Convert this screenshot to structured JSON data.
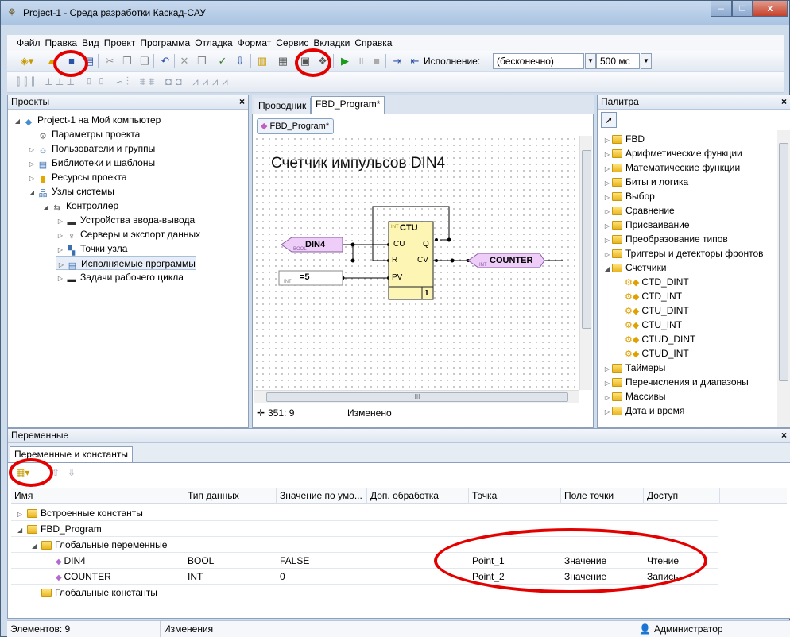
{
  "window": {
    "title": "Project-1 - Среда разработки Каскад-САУ",
    "min": "–",
    "max": "□",
    "close": "x"
  },
  "menu": [
    "Файл",
    "Правка",
    "Вид",
    "Проект",
    "Программа",
    "Отладка",
    "Формат",
    "Сервис",
    "Вкладки",
    "Справка"
  ],
  "toolbar": {
    "exec_label": "Исполнение:",
    "exec_value": "(бесконечно)",
    "period_value": "500 мс"
  },
  "projects": {
    "title": "Проекты",
    "close": "×",
    "items": [
      {
        "label": "Project-1 на Мой компьютер",
        "icon": "project-icon",
        "level": 0,
        "expanded": true
      },
      {
        "label": "Параметры проекта",
        "icon": "settings-icon",
        "level": 1
      },
      {
        "label": "Пользователи и группы",
        "icon": "users-icon",
        "level": 1,
        "collapsed": true
      },
      {
        "label": "Библиотеки и шаблоны",
        "icon": "library-icon",
        "level": 1,
        "collapsed": true
      },
      {
        "label": "Ресурсы проекта",
        "icon": "resources-icon",
        "level": 1,
        "collapsed": true
      },
      {
        "label": "Узлы системы",
        "icon": "network-icon",
        "level": 1,
        "expanded": true
      },
      {
        "label": "Контроллер",
        "icon": "controller-icon",
        "level": 2,
        "expanded": true
      },
      {
        "label": "Устройства ввода-вывода",
        "icon": "io-device-icon",
        "level": 3,
        "collapsed": true
      },
      {
        "label": "Серверы и экспорт данных",
        "icon": "server-icon",
        "level": 3,
        "collapsed": true
      },
      {
        "label": "Точки узла",
        "icon": "points-icon",
        "level": 3,
        "collapsed": true
      },
      {
        "label": "Исполняемые программы",
        "icon": "programs-icon",
        "level": 3,
        "collapsed": true,
        "selected": true
      },
      {
        "label": "Задачи рабочего цикла",
        "icon": "tasks-icon",
        "level": 3,
        "collapsed": true
      }
    ]
  },
  "editor": {
    "tabs": [
      "Проводник",
      "FBD_Program*"
    ],
    "doc_tab": "FBD_Program*",
    "title": "Счетчик импульсов DIN4",
    "block": {
      "type_tag": "INT",
      "name": "CTU",
      "in1": "CU",
      "in2": "R",
      "in3": "PV",
      "out1": "Q",
      "out2": "CV",
      "order": "1"
    },
    "din4": {
      "type_tag": "BOOL",
      "name": "DIN4"
    },
    "const": {
      "type_tag": "INT",
      "name": "=5"
    },
    "counter": {
      "type_tag": "INT",
      "name": "COUNTER"
    },
    "coords": "351: 9",
    "status": "Изменено",
    "hscroll_mark": "III"
  },
  "palette": {
    "title": "Палитра",
    "close": "×",
    "items": [
      {
        "label": "FBD",
        "kind": "folder"
      },
      {
        "label": "Арифметические функции",
        "kind": "folder"
      },
      {
        "label": "Математические функции",
        "kind": "folder"
      },
      {
        "label": "Биты и логика",
        "kind": "folder"
      },
      {
        "label": "Выбор",
        "kind": "folder"
      },
      {
        "label": "Сравнение",
        "kind": "folder"
      },
      {
        "label": "Присваивание",
        "kind": "folder"
      },
      {
        "label": "Преобразование типов",
        "kind": "folder"
      },
      {
        "label": "Триггеры и детекторы фронтов",
        "kind": "folder"
      },
      {
        "label": "Счетчики",
        "kind": "folder-open"
      },
      {
        "label": "CTD_DINT",
        "kind": "block"
      },
      {
        "label": "CTD_INT",
        "kind": "block"
      },
      {
        "label": "CTU_DINT",
        "kind": "block"
      },
      {
        "label": "CTU_INT",
        "kind": "block"
      },
      {
        "label": "CTUD_DINT",
        "kind": "block"
      },
      {
        "label": "CTUD_INT",
        "kind": "block"
      },
      {
        "label": "Таймеры",
        "kind": "folder"
      },
      {
        "label": "Перечисления и диапазоны",
        "kind": "folder"
      },
      {
        "label": "Массивы",
        "kind": "folder"
      },
      {
        "label": "Дата и время",
        "kind": "folder"
      }
    ]
  },
  "variables": {
    "title": "Переменные",
    "close": "×",
    "tab": "Переменные и константы",
    "columns": [
      "Имя",
      "Тип данных",
      "Значение по умо...",
      "Доп. обработка",
      "Точка",
      "Поле точки",
      "Доступ"
    ],
    "rows": [
      {
        "name": "Встроенные константы",
        "kind": "folder",
        "level": 1,
        "collapsed": true
      },
      {
        "name": "FBD_Program",
        "kind": "folder",
        "level": 1,
        "expanded": true
      },
      {
        "name": "Глобальные переменные",
        "kind": "folder",
        "level": 2,
        "expanded": true
      },
      {
        "name": "DIN4",
        "kind": "var",
        "level": 3,
        "type": "BOOL",
        "default": "FALSE",
        "extra": "",
        "point": "Point_1",
        "field": "Значение",
        "access": "Чтение"
      },
      {
        "name": "COUNTER",
        "kind": "var",
        "level": 3,
        "type": "INT",
        "default": "0",
        "extra": "",
        "point": "Point_2",
        "field": "Значение",
        "access": "Запись"
      },
      {
        "name": "Глобальные константы",
        "kind": "folder",
        "level": 2
      }
    ]
  },
  "statusbar": {
    "count": "Элементов: 9",
    "state": "Изменения",
    "user": "Администратор"
  },
  "colors": {
    "highlight": "#e50000",
    "block_fill": "#fdf5b4",
    "var_tag_fill": "#efcdf9"
  }
}
